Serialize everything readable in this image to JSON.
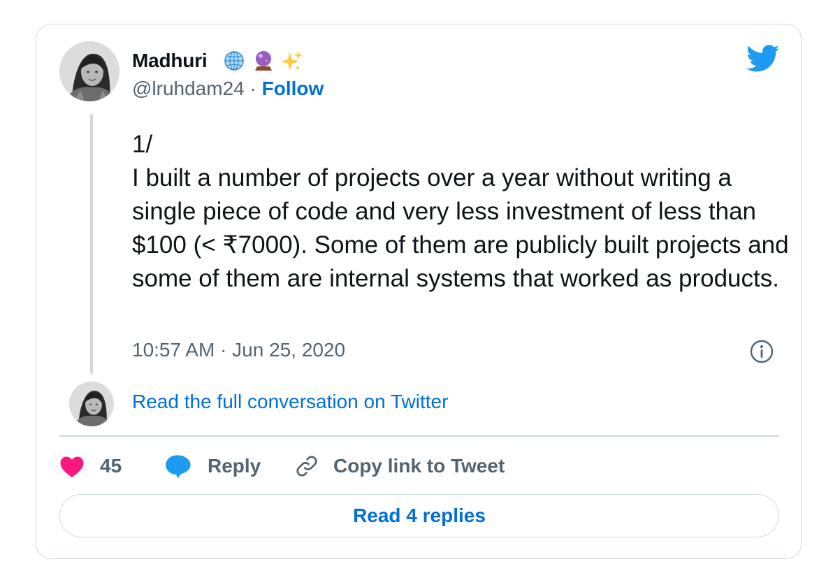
{
  "author": {
    "display_name": "Madhuri",
    "name_emojis": [
      "globe-with-meridians-icon",
      "crystal-ball-icon",
      "sparkles-icon"
    ],
    "handle": "@lruhdam24",
    "separator": "·",
    "follow_label": "Follow"
  },
  "tweet": {
    "text": "1/\nI built a number of projects over a year without writing a single piece of code and very less investment of less than $100 (< ₹7000). Some of them are publicly built projects and some of them are internal systems that worked as products.",
    "timestamp": "10:57 AM · Jun 25, 2020"
  },
  "conversation": {
    "link_label": "Read the full conversation on Twitter"
  },
  "actions": {
    "like_count": "45",
    "reply_label": "Reply",
    "copy_link_label": "Copy link to Tweet"
  },
  "replies": {
    "button_label": "Read 4 replies"
  },
  "colors": {
    "link_blue": "#006fd6",
    "twitter_blue": "#1d9bf0",
    "like_pink": "#f91880",
    "secondary_text": "#536471",
    "border": "#cfd9de"
  }
}
